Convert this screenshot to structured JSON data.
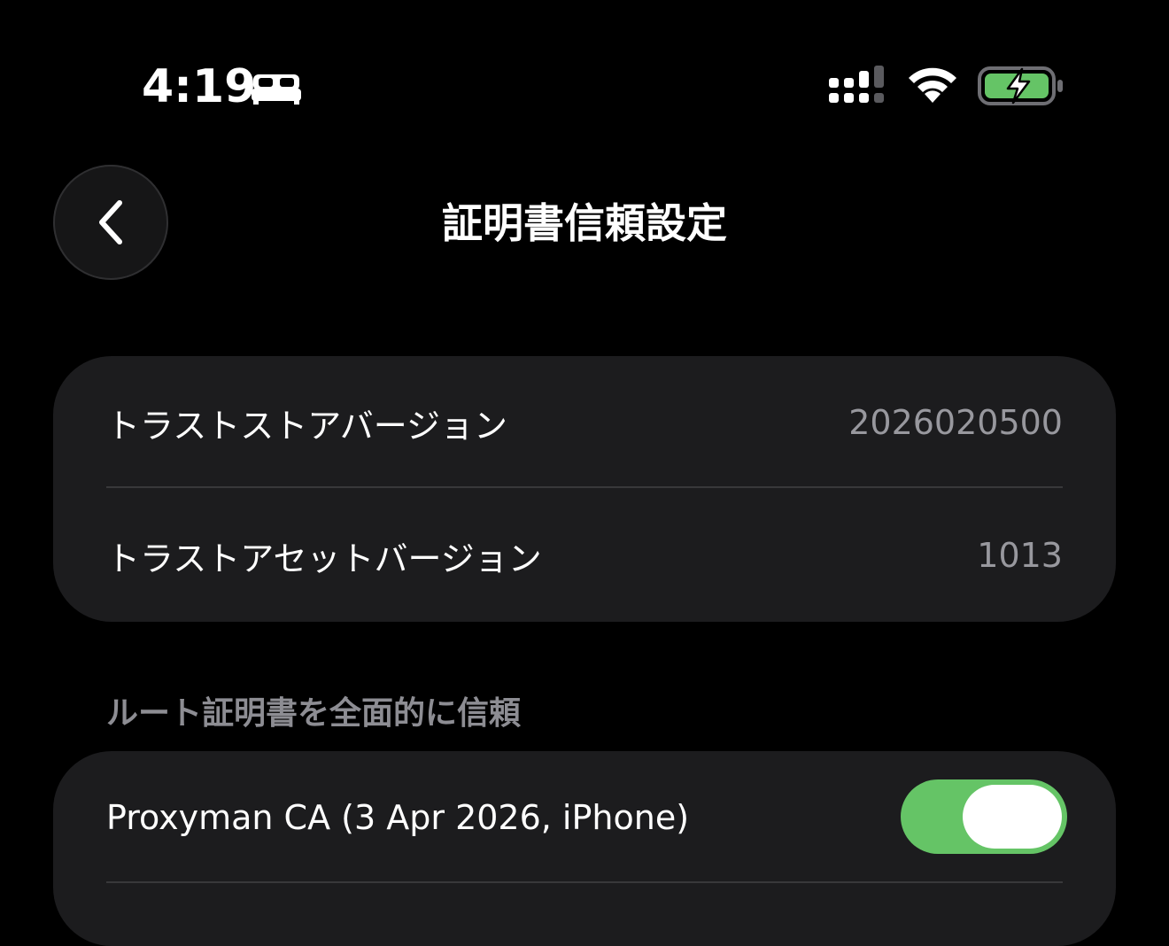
{
  "status_bar": {
    "time": "4:19",
    "focus_icon": "bed-icon",
    "signal_icon": "cellular-signal-icon",
    "wifi_icon": "wifi-icon",
    "battery_icon": "battery-charging-icon",
    "battery_color": "#65c466"
  },
  "nav": {
    "back_icon": "chevron-left-icon",
    "title": "証明書信頼設定"
  },
  "info_card": {
    "rows": [
      {
        "label": "トラストストアバージョン",
        "value": "2026020500"
      },
      {
        "label": "トラストアセットバージョン",
        "value": "1013"
      }
    ]
  },
  "certs_section": {
    "header": "ルート証明書を全面的に信頼",
    "items": [
      {
        "label": "Proxyman CA (3 Apr 2026, iPhone)",
        "enabled": true
      }
    ]
  },
  "colors": {
    "background": "#000000",
    "card": "#1c1c1e",
    "secondary_text": "#98989e",
    "toggle_on": "#65c466"
  }
}
